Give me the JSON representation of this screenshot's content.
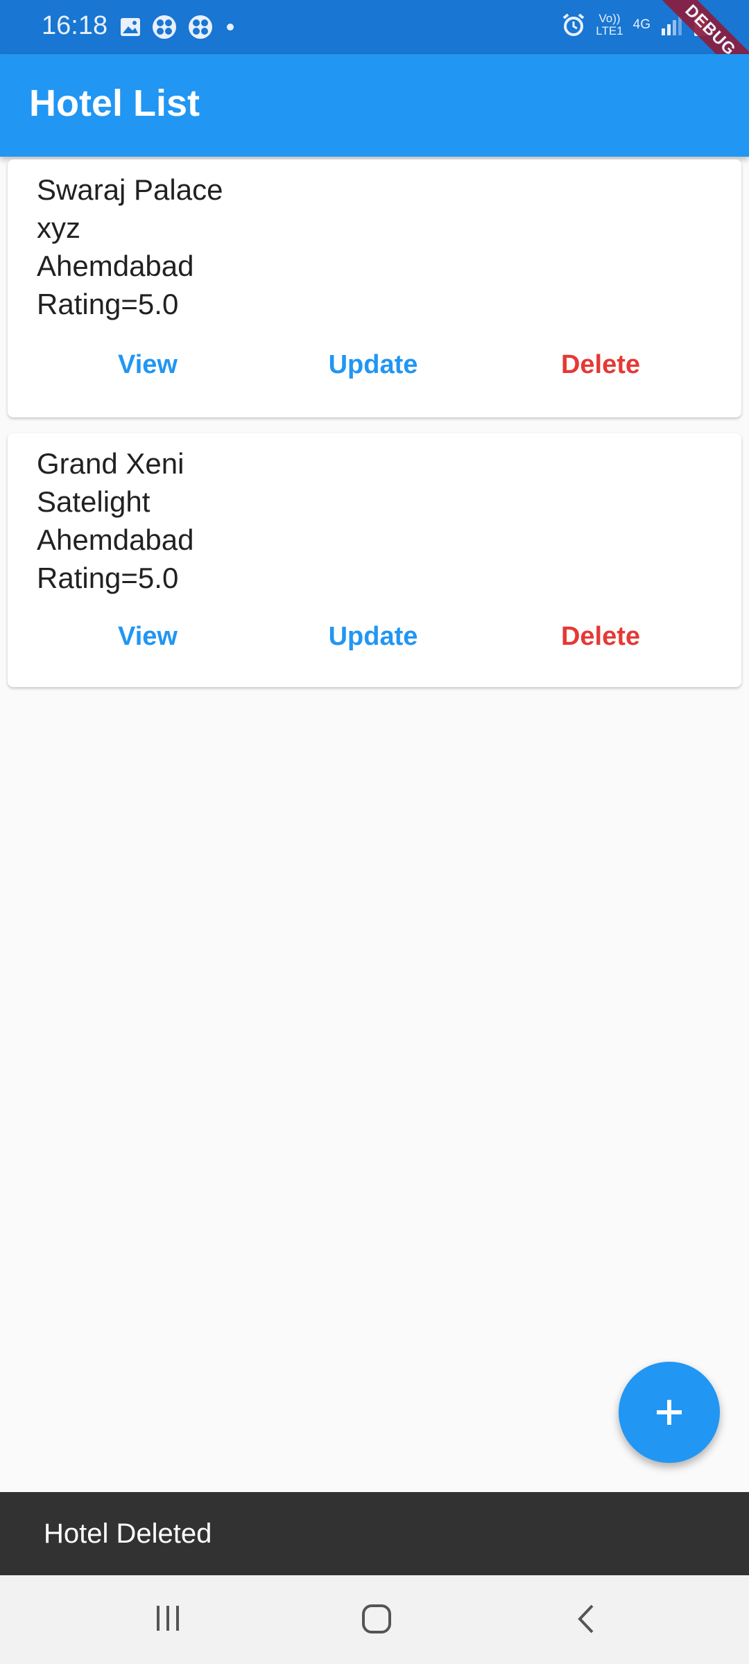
{
  "status_bar": {
    "time": "16:18",
    "left_icons": [
      "image-icon",
      "fan-icon",
      "fan-icon",
      "dot-icon"
    ],
    "right_icons": [
      "alarm-icon",
      "volte-icon",
      "4g-icon",
      "signal-icon",
      "battery-icon"
    ],
    "volte_label_top": "Vo))",
    "volte_label_bottom": "LTE1",
    "network_label": "4G",
    "debug_label": "DEBUG"
  },
  "app_bar": {
    "title": "Hotel List",
    "color": "#2196f3"
  },
  "hotels": [
    {
      "name": "Swaraj Palace",
      "address": "xyz",
      "city": "Ahemdabad",
      "rating": "Rating=5.0",
      "actions": {
        "view": "View",
        "update": "Update",
        "delete": "Delete"
      }
    },
    {
      "name": "Grand Xeni",
      "address": "Satelight",
      "city": "Ahemdabad",
      "rating": "Rating=5.0",
      "actions": {
        "view": "View",
        "update": "Update",
        "delete": "Delete"
      }
    }
  ],
  "fab": {
    "icon": "plus-icon"
  },
  "snackbar": {
    "message": "Hotel Deleted"
  },
  "nav_bar": {
    "icons": [
      "recent-apps-icon",
      "home-icon",
      "back-icon"
    ]
  },
  "colors": {
    "accent": "#2196f3",
    "delete": "#e53935",
    "snackbar": "#323232"
  }
}
